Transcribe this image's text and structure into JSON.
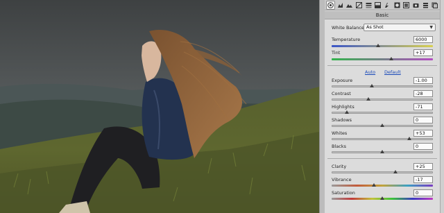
{
  "panel": {
    "title": "Basic",
    "white_balance": {
      "label": "White Balance:",
      "value": "As Shot"
    },
    "auto_label": "Auto",
    "default_label": "Default",
    "sliders": [
      {
        "id": "temperature",
        "label": "Temperature",
        "value": "6000",
        "position": 0.46,
        "track": "temp"
      },
      {
        "id": "tint",
        "label": "Tint",
        "value": "+17",
        "position": 0.59,
        "track": "tint"
      },
      {
        "id": "exposure",
        "label": "Exposure",
        "value": "-1.00",
        "position": 0.4,
        "track": "plain"
      },
      {
        "id": "contrast",
        "label": "Contrast",
        "value": "-28",
        "position": 0.36,
        "track": "plain"
      },
      {
        "id": "highlights",
        "label": "Highlights",
        "value": "-71",
        "position": 0.15,
        "track": "plain"
      },
      {
        "id": "shadows",
        "label": "Shadows",
        "value": "0",
        "position": 0.5,
        "track": "plain"
      },
      {
        "id": "whites",
        "label": "Whites",
        "value": "+53",
        "position": 0.77,
        "track": "plain"
      },
      {
        "id": "blacks",
        "label": "Blacks",
        "value": "0",
        "position": 0.5,
        "track": "plain"
      },
      {
        "id": "clarity",
        "label": "Clarity",
        "value": "+25",
        "position": 0.63,
        "track": "plain"
      },
      {
        "id": "vibrance",
        "label": "Vibrance",
        "value": "-17",
        "position": 0.42,
        "track": "vib"
      },
      {
        "id": "saturation",
        "label": "Saturation",
        "value": "0",
        "position": 0.5,
        "track": "sat"
      }
    ]
  },
  "toolbar": {
    "icons": [
      "aperture-icon",
      "histogram-icon",
      "mountains-icon",
      "tone-curve-icon",
      "hsl-icon",
      "split-toning-icon",
      "detail-icon",
      "lens-icon",
      "effects-icon",
      "camera-calibration-icon",
      "presets-icon",
      "snapshots-icon"
    ]
  },
  "colors": {
    "panel_bg": "#dcdcdc",
    "link": "#1848b8",
    "sky": "#4a4d4e"
  }
}
